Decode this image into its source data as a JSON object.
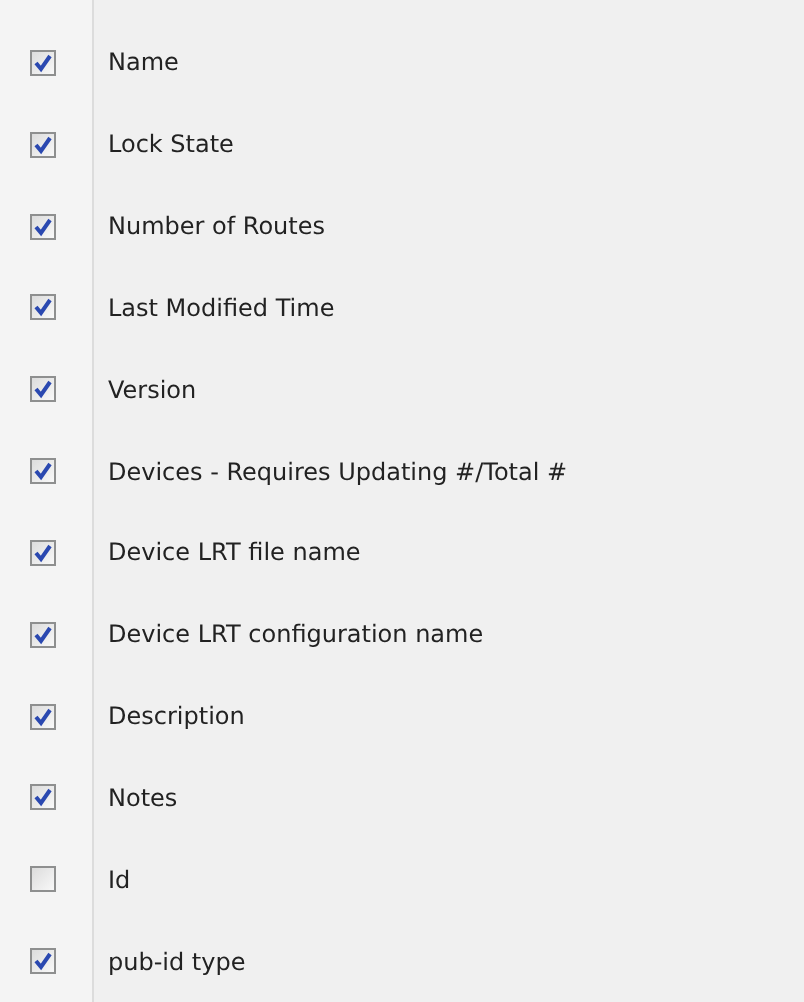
{
  "columns": [
    {
      "label": "Name",
      "checked": true
    },
    {
      "label": "Lock State",
      "checked": true
    },
    {
      "label": "Number of Routes",
      "checked": true
    },
    {
      "label": "Last Modified Time",
      "checked": true
    },
    {
      "label": "Version",
      "checked": true
    },
    {
      "label": "Devices - Requires Updating #/Total #",
      "checked": true
    },
    {
      "label": "Device LRT file name",
      "checked": true
    },
    {
      "label": "Device LRT configuration name",
      "checked": true
    },
    {
      "label": "Description",
      "checked": true
    },
    {
      "label": "Notes",
      "checked": true
    },
    {
      "label": "Id",
      "checked": false
    },
    {
      "label": "pub-id type",
      "checked": true
    }
  ]
}
